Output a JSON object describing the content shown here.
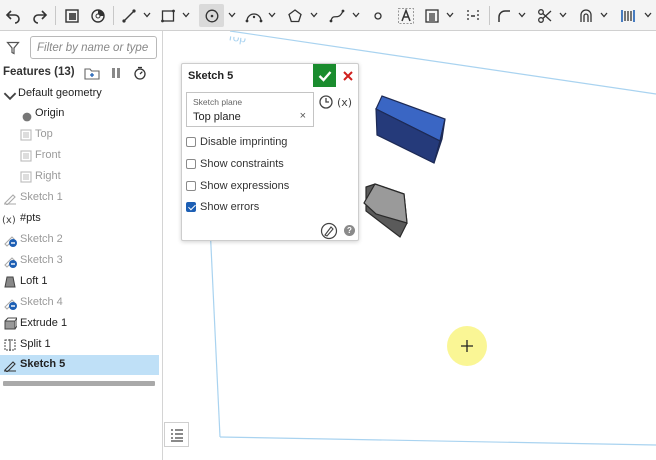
{
  "toolbar": {
    "buttons": [
      {
        "name": "undo-icon"
      },
      {
        "name": "redo-icon"
      },
      {
        "name": "feature-list-icon"
      },
      {
        "name": "view-mode-icon"
      },
      {
        "name": "line-tool-icon"
      },
      {
        "name": "rectangle-tool-icon"
      },
      {
        "name": "circle-tool-icon",
        "active": true
      },
      {
        "name": "arc-tool-icon"
      },
      {
        "name": "polygon-tool-icon"
      },
      {
        "name": "spline-tool-icon"
      },
      {
        "name": "point-tool-icon"
      },
      {
        "name": "text-tool-icon"
      },
      {
        "name": "use-tool-icon"
      },
      {
        "name": "construction-tool-icon"
      },
      {
        "name": "fillet-tool-icon"
      },
      {
        "name": "trim-tool-icon"
      },
      {
        "name": "offset-tool-icon"
      },
      {
        "name": "dimension-tool-icon"
      }
    ]
  },
  "filter": {
    "placeholder": "Filter by name or type"
  },
  "features": {
    "title": "Features (13)",
    "items": [
      {
        "label": "Default geometry",
        "style": "group"
      },
      {
        "label": "Origin",
        "style": "normal"
      },
      {
        "label": "Top",
        "style": "dim"
      },
      {
        "label": "Front",
        "style": "dim"
      },
      {
        "label": "Right",
        "style": "dim"
      },
      {
        "label": "Sketch 1",
        "style": "dim"
      },
      {
        "label": "#pts",
        "style": "normal"
      },
      {
        "label": "Sketch 2",
        "style": "dim"
      },
      {
        "label": "Sketch 3",
        "style": "dim"
      },
      {
        "label": "Loft 1",
        "style": "normal"
      },
      {
        "label": "Sketch 4",
        "style": "dim"
      },
      {
        "label": "Extrude 1",
        "style": "normal"
      },
      {
        "label": "Split 1",
        "style": "normal"
      },
      {
        "label": "Sketch 5",
        "style": "selected"
      }
    ]
  },
  "dialog": {
    "title": "Sketch 5",
    "plane_label": "Sketch plane",
    "plane_value": "Top plane",
    "plane_clear": "×",
    "options": [
      {
        "label": "Disable imprinting",
        "checked": false
      },
      {
        "label": "Show constraints",
        "checked": false
      },
      {
        "label": "Show expressions",
        "checked": false
      },
      {
        "label": "Show errors",
        "checked": true
      }
    ],
    "help": "?"
  },
  "canvas": {
    "plane_tag": "Top",
    "colors": {
      "selected_part": "#3a66c4",
      "part": "#8e8e8e",
      "plane_edge": "#a9d3f0",
      "cursor": "#f9f58a"
    }
  }
}
